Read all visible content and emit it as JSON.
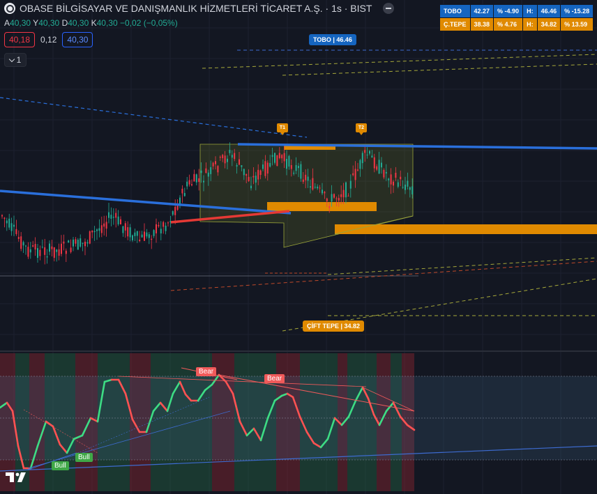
{
  "header": {
    "title": "OBASE BİLGİSAYAR VE DANIŞMANLIK HİZMETLERİ TİCARET A.Ş. · 1s · BIST"
  },
  "ohlc": {
    "open_key": "A",
    "open": "40,30",
    "high_key": "Y",
    "high": "40,30",
    "low_key": "D",
    "low": "40,30",
    "close_key": "K",
    "close": "40,30",
    "change": "−0,02 (−0,05%)"
  },
  "prices": {
    "sell": "40,18",
    "spread": "0,12",
    "buy": "40,30"
  },
  "collapse": {
    "count": "1"
  },
  "info_table": [
    [
      "TOBO",
      "42.27",
      "% -4.90",
      "H:",
      "46.46",
      "% -15.28"
    ],
    [
      "Ç.TEPE",
      "38.38",
      "% 4.76",
      "H:",
      "34.82",
      "% 13.59"
    ]
  ],
  "labels": {
    "tobo": "TOBO | 46.46",
    "cift_tepe": "ÇİFT TEPE | 34.82",
    "t1": "T1",
    "t2": "T2",
    "bear1": "Bear",
    "bear2": "Bear",
    "bull1": "Bull",
    "bull2": "Bull"
  },
  "colors": {
    "background": "#131722",
    "up": "#22ab94",
    "down": "#f23645",
    "blue_trend": "#2a6fdb",
    "orange": "#e08a00",
    "osc_up": "#3ddc84",
    "osc_down": "#ff5252"
  },
  "icons": {
    "logo": "symbol-logo-icon",
    "remove": "minus-circle-icon",
    "collapse": "chevron-down-icon",
    "brand": "tradingview-logo-icon"
  }
}
